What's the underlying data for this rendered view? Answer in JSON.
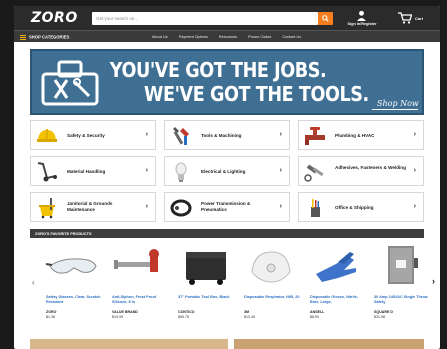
{
  "header": {
    "logo": "ZORO",
    "search_placeholder": "Get your search on...",
    "account_label": "Sign In/Register",
    "cart_label": "Cart"
  },
  "nav": {
    "shop_categories": "SHOP CATEGORIES",
    "links": [
      "About Us",
      "Payment Options",
      "Resources",
      "Promo Codes",
      "Contact Us"
    ]
  },
  "hero": {
    "line1": "YOU'VE GOT THE JOBS.",
    "line2": "WE'VE GOT THE TOOLS.",
    "cta": "Shop Now"
  },
  "categories": [
    {
      "name": "Safety & Security",
      "icon": "hard-hat-icon"
    },
    {
      "name": "Tools & Machining",
      "icon": "wrench-icon"
    },
    {
      "name": "Plumbing & HVAC",
      "icon": "pipe-valve-icon"
    },
    {
      "name": "Material Handling",
      "icon": "hand-truck-icon"
    },
    {
      "name": "Electrical & Lighting",
      "icon": "light-bulb-icon"
    },
    {
      "name": "Adhesives, Fasteners & Welding",
      "icon": "bolt-icon"
    },
    {
      "name": "Janitorial & Grounds Maintenance",
      "icon": "mop-bucket-icon"
    },
    {
      "name": "Power Transmission & Pneumatics",
      "icon": "belt-pulley-icon"
    },
    {
      "name": "Office & Shipping",
      "icon": "pen-cup-icon"
    }
  ],
  "favorites": {
    "heading": "ZORO'S FAVORITE PRODUCTS",
    "products": [
      {
        "title": "Safety Glasses, Clear, Scratch Resistant",
        "brand": "ZORO",
        "price": "$1.38"
      },
      {
        "title": "Anti-Siphon, Frost Proof Sillcock, 8 in",
        "brand": "VALUE BRAND",
        "price": "$19.99"
      },
      {
        "title": "37\" Portable Tool Box, Black",
        "brand": "CONTICO",
        "price": "$59.75"
      },
      {
        "title": "Disposable Respirator, N95, 20",
        "brand": "3M",
        "price": "$13.45"
      },
      {
        "title": "Disposable Gloves, Nitrile, Blue, Large,",
        "brand": "ANSELL",
        "price": "$8.99"
      },
      {
        "title": "30 Amp 240VAC Single Throw Safety",
        "brand": "SQUARE D",
        "price": "$31.98"
      }
    ]
  },
  "colors": {
    "accent": "#f57f20",
    "topbar": "#2b2b2b",
    "hero": "#3f6f93",
    "link": "#2a6fc0"
  }
}
